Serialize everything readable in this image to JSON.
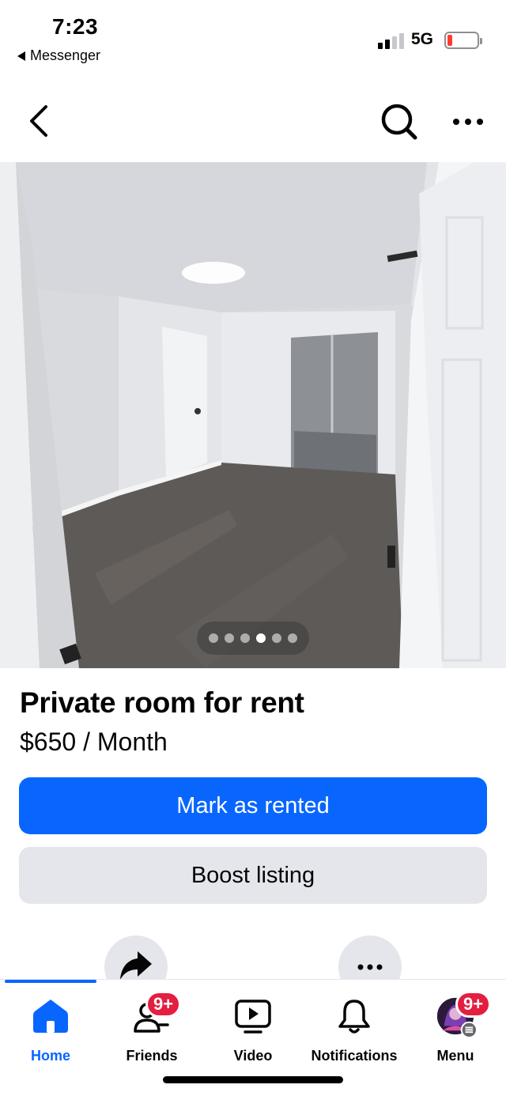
{
  "status_bar": {
    "time": "7:23",
    "back_app": "Messenger",
    "network": "5G"
  },
  "nav": {
    "back_icon": "chevron-left-icon",
    "search_icon": "search-icon",
    "more_icon": "more-horizontal-icon"
  },
  "gallery": {
    "photo_count": 6,
    "active_index": 3
  },
  "listing": {
    "title": "Private room for rent",
    "price": "$650 / Month"
  },
  "actions": {
    "primary_label": "Mark as rented",
    "secondary_label": "Boost listing",
    "share_icon": "share-icon",
    "more_icon": "more-horizontal-icon"
  },
  "tabs": [
    {
      "label": "Home",
      "icon": "home-icon",
      "active": true,
      "badge": ""
    },
    {
      "label": "Friends",
      "icon": "friends-icon",
      "active": false,
      "badge": "9+"
    },
    {
      "label": "Video",
      "icon": "video-icon",
      "active": false,
      "badge": ""
    },
    {
      "label": "Notifications",
      "icon": "bell-icon",
      "active": false,
      "badge": ""
    },
    {
      "label": "Menu",
      "icon": "avatar",
      "active": false,
      "badge": "9+"
    }
  ],
  "colors": {
    "accent": "#0866ff",
    "badge": "#e41e3f",
    "secondary_button": "#e4e6eb",
    "battery_low": "#ff3b30"
  }
}
